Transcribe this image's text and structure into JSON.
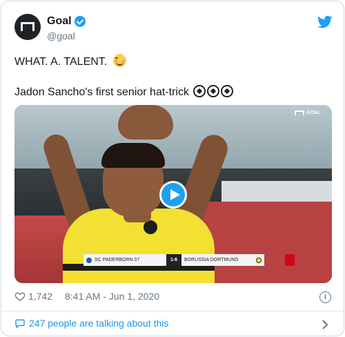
{
  "author": {
    "display_name": "Goal",
    "handle": "@goal",
    "verified": true
  },
  "tweet": {
    "line1": "WHAT. A. TALENT.",
    "line1_emoji": "smiling-face-emoji",
    "line2": "Jadon Sancho's first senior hat-trick",
    "line2_emoji": "soccer-ball-emoji x3"
  },
  "media": {
    "type": "video",
    "logo_text": "GOAL",
    "scoreboard": {
      "home": "SC PADERBORN 07",
      "score": "1-6",
      "away": "BORUSSIA DORTMUND"
    }
  },
  "meta": {
    "likes": "1,742",
    "timestamp": "8:41 AM - Jun 1, 2020"
  },
  "conversation": {
    "label": "247 people are talking about this"
  },
  "colors": {
    "twitter_blue": "#1da1f2",
    "link_blue": "#1b95e0",
    "muted_gray": "#657786",
    "border": "#cfd9de"
  }
}
